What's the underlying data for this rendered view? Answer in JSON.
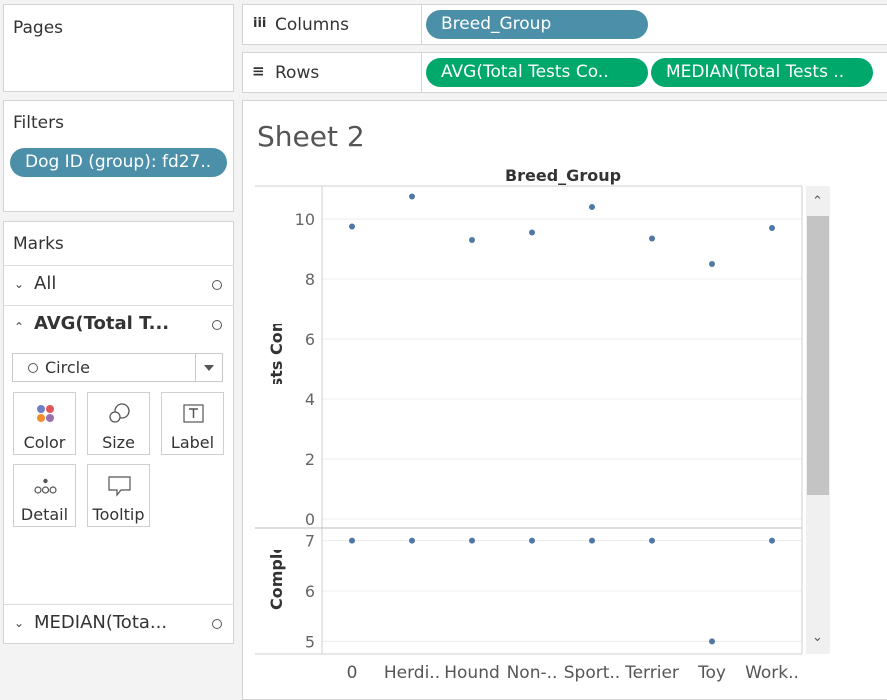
{
  "pages": {
    "title": "Pages"
  },
  "filters": {
    "title": "Filters",
    "pill": "Dog ID (group): fd27.."
  },
  "shelves": {
    "columns": {
      "label": "Columns",
      "icon": "iii",
      "pills": [
        "Breed_Group"
      ]
    },
    "rows": {
      "label": "Rows",
      "icon": "≡",
      "pills": [
        "AVG(Total Tests Co..",
        "MEDIAN(Total Tests .."
      ]
    }
  },
  "marks": {
    "title": "Marks",
    "cards": [
      {
        "label": "All",
        "expanded": false
      },
      {
        "label": "AVG(Total T...",
        "expanded": true
      },
      {
        "label": "MEDIAN(Tota...",
        "expanded": false
      }
    ],
    "mark_type": "Circle",
    "buttons": [
      "Color",
      "Size",
      "Label",
      "Detail",
      "Tooltip"
    ],
    "icons": [
      "color-icon",
      "size-icon",
      "label-icon",
      "detail-icon",
      "tooltip-icon"
    ]
  },
  "sheet": {
    "title": "Sheet 2",
    "header": "Breed_Group"
  },
  "chart_data": {
    "type": "scatter",
    "categories": [
      "0",
      "Herdi..",
      "Hound",
      "Non-..",
      "Sport..",
      "Terrier",
      "Toy",
      "Work.."
    ],
    "mark_color": "#4e79a7",
    "series": [
      {
        "values": [
          9.75,
          10.75,
          9.3,
          9.55,
          10.4,
          9.35,
          8.5,
          9.7
        ],
        "ylabel": "Total Tests Completed",
        "yticks": [
          0,
          2,
          4,
          6,
          8,
          10
        ],
        "ylim": [
          -0.3,
          11.1
        ]
      },
      {
        "values": [
          7,
          7,
          7,
          7,
          7,
          7,
          5,
          7
        ],
        "ylabel": "ests Completed",
        "yticks": [
          5,
          6,
          7
        ],
        "ylim": [
          4.75,
          7.25
        ]
      }
    ],
    "grid": true
  }
}
